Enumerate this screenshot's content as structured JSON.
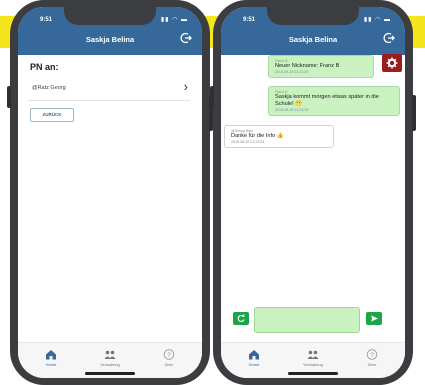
{
  "left_phone": {
    "status": {
      "time": "9:51",
      "signal": "▮▮ ◠ ▬"
    },
    "header": {
      "title": "Saskja Belina"
    },
    "pn_heading": "PN an:",
    "contact": {
      "name": "@Ratz Georg"
    },
    "back_button": "ZURÜCK",
    "tabs": [
      {
        "label": "Home"
      },
      {
        "label": "Verwaltung"
      },
      {
        "label": "Über"
      }
    ]
  },
  "right_phone": {
    "status": {
      "time": "9:51",
      "signal": "▮▮ ◠ ▬"
    },
    "header": {
      "title": "Saskja Belina"
    },
    "messages": [
      {
        "sender": "Franz B",
        "text": "Neuer Nickname: Franz B",
        "time": "2019-08-19 21:21:20"
      },
      {
        "sender": "Franz B",
        "text": "Saskja kommt morgen etwas später in die Schule! 😬",
        "time": "2019-08-19 21:23:29"
      },
      {
        "sender": "@Georg Ratz",
        "text": "Danke für die Info 👍",
        "time": "2019-08-19 21:23:51"
      }
    ],
    "compose_value": "",
    "tabs": [
      {
        "label": "Home"
      },
      {
        "label": "Verwaltung"
      },
      {
        "label": "Über"
      }
    ]
  },
  "colors": {
    "header": "#36699a",
    "my_bubble": "#c9f2c0",
    "accent_green": "#1aa548",
    "gear_red": "#9b1c1c",
    "highlight": "#f5e51d"
  }
}
